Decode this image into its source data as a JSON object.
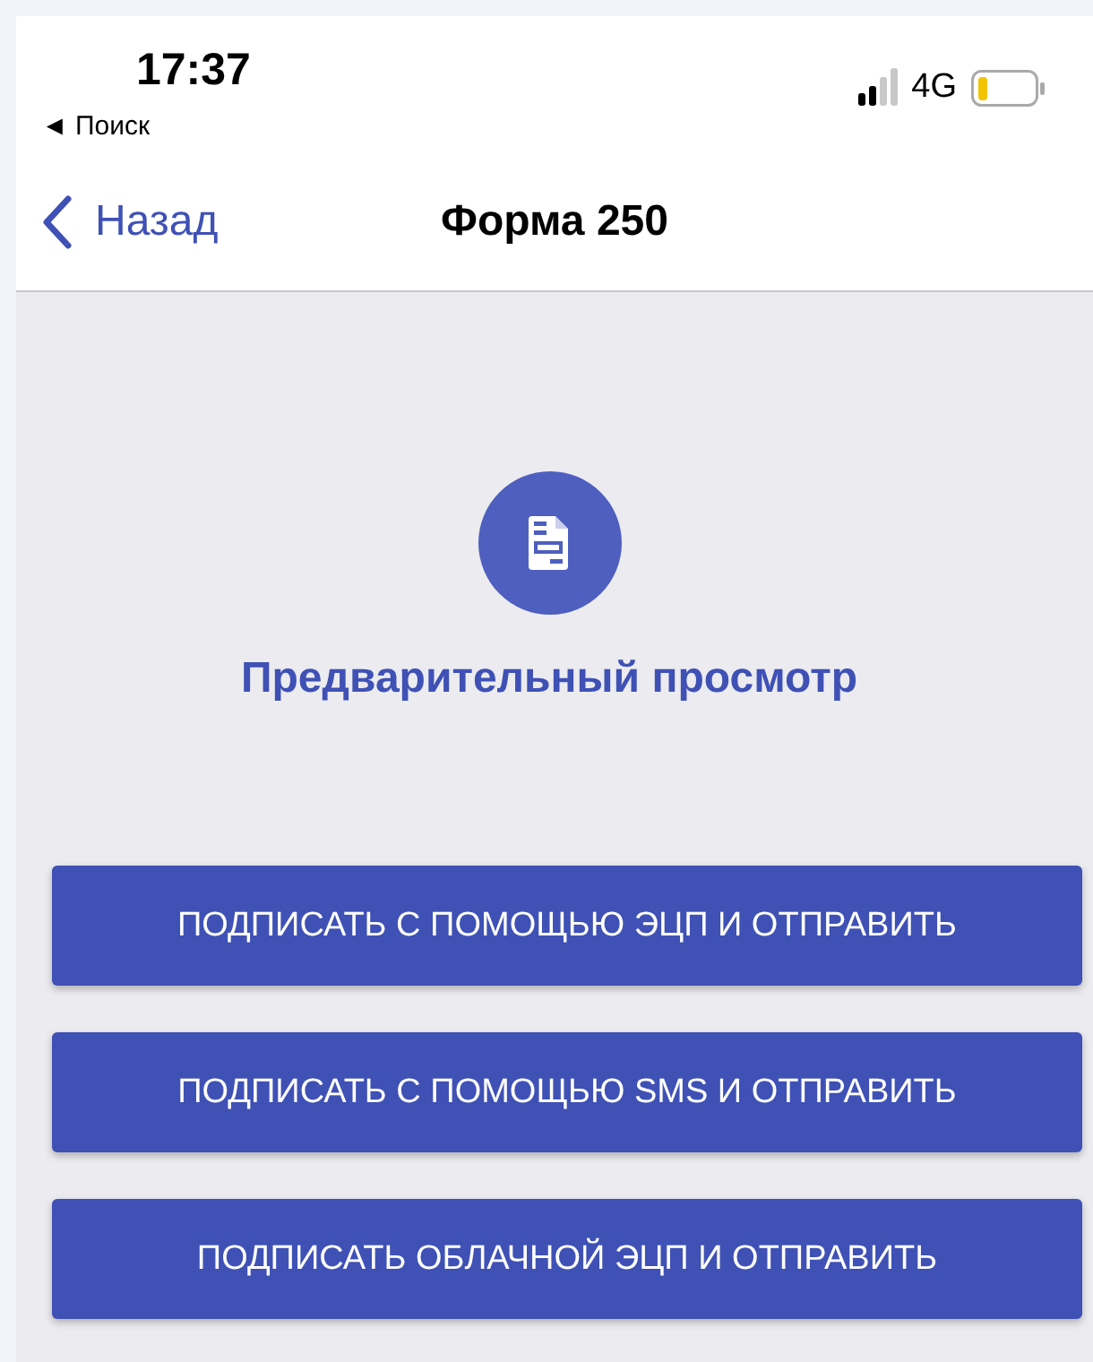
{
  "status_bar": {
    "time": "17:37",
    "back_app": "◄ Поиск",
    "network": "4G"
  },
  "nav_bar": {
    "back": "Назад",
    "title": "Форма 250"
  },
  "preview": {
    "title": "Предварительный просмотр"
  },
  "buttons": [
    {
      "label": "ПОДПИСАТЬ С ПОМОЩЬЮ ЭЦП И ОТПРАВИТЬ"
    },
    {
      "label": "ПОДПИСАТЬ С ПОМОЩЬЮ SMS И ОТПРАВИТЬ"
    },
    {
      "label": "ПОДПИСАТЬ ОБЛАЧНОЙ ЭЦП И ОТПРАВИТЬ"
    }
  ]
}
